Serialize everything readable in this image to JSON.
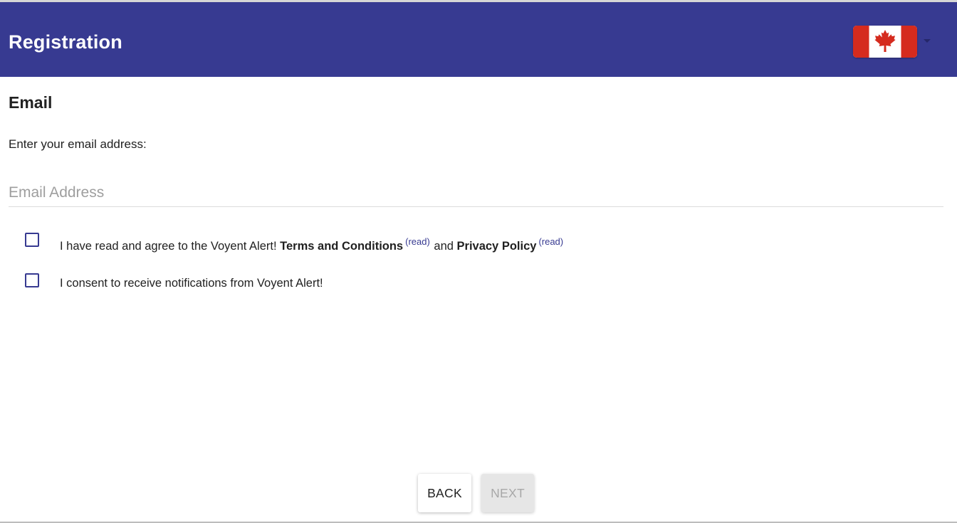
{
  "header": {
    "title": "Registration",
    "language_flag_icon": "canada-flag-icon",
    "dropdown_icon": "caret-down-icon",
    "colors": {
      "toolbar": "#373a91",
      "flag_red": "#d52b1e",
      "flag_white": "#ffffff"
    }
  },
  "form": {
    "section_title": "Email",
    "prompt": "Enter your email address:",
    "email_value": "",
    "email_placeholder": "Email Address"
  },
  "consents": {
    "terms": {
      "checked": false,
      "prefix": "I have read and agree to the Voyent Alert!",
      "terms_label": "Terms and Conditions",
      "terms_read": "(read)",
      "conjunction": "and",
      "privacy_label": "Privacy Policy",
      "privacy_read": "(read)"
    },
    "notifications": {
      "checked": false,
      "label": "I consent to receive notifications from Voyent Alert!"
    }
  },
  "actions": {
    "back_label": "BACK",
    "next_label": "NEXT",
    "next_disabled": true
  }
}
